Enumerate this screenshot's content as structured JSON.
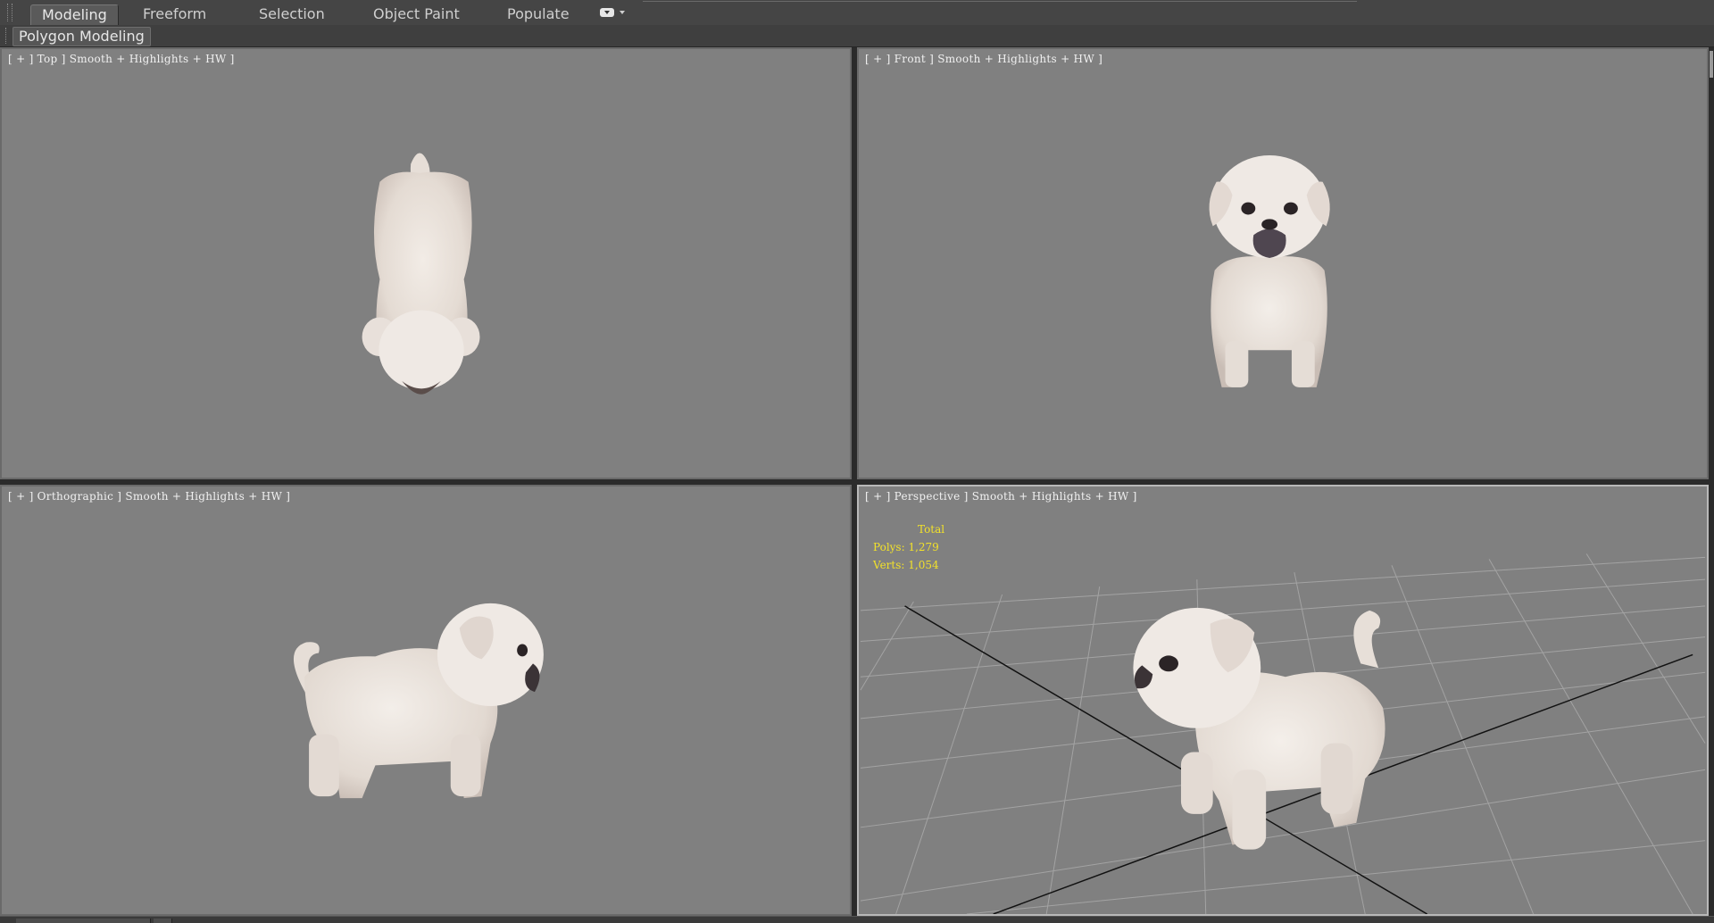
{
  "ribbon": {
    "tabs": [
      {
        "label": "Modeling",
        "active": true
      },
      {
        "label": "Freeform",
        "active": false
      },
      {
        "label": "Selection",
        "active": false
      },
      {
        "label": "Object Paint",
        "active": false
      },
      {
        "label": "Populate",
        "active": false
      }
    ],
    "options_icon": "ribbon-display-options-icon",
    "panel_title": "Polygon Modeling"
  },
  "viewports": {
    "top": {
      "label": "[ + ] Top ] Smooth + Highlights + HW ]"
    },
    "front": {
      "label": "[ + ] Front ] Smooth + Highlights + HW ]"
    },
    "orthographic": {
      "label": "[ + ] Orthographic ] Smooth + Highlights + HW ]"
    },
    "perspective": {
      "label": "[ + ] Perspective ] Smooth + Highlights + HW ]",
      "stats": {
        "total_label": "Total",
        "polys": "Polys: 1,279",
        "verts": "Verts: 1,054"
      }
    }
  },
  "colors": {
    "viewport_bg": "#808080",
    "ui_dark": "#3c3c3c",
    "stats_text": "#f2e12a",
    "model_fur": "#e9e2dc"
  }
}
